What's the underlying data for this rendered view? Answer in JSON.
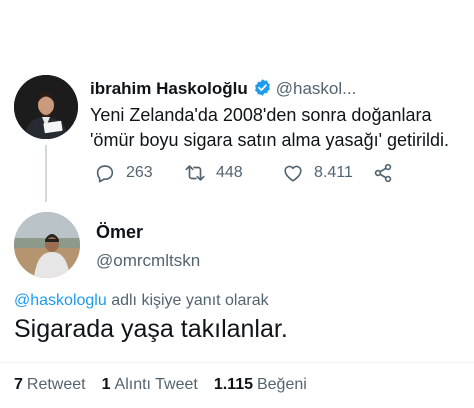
{
  "parent_tweet": {
    "author_name": "ibrahim Haskoloğlu",
    "handle": "@haskol...",
    "text": "Yeni Zelanda'da 2008'den sonra doğanlara 'ömür boyu sigara satın alma yasağı' getirildi.",
    "replies": "263",
    "retweets": "448",
    "likes": "8.411",
    "verified_color": "#1d9bf0"
  },
  "reply_tweet": {
    "author_name": "Ömer",
    "handle": "@omrcmltskn",
    "reply_to_mention": "@haskologlu",
    "reply_to_suffix": " adlı kişiye yanıt olarak",
    "text": "Sigarada yaşa takılanlar."
  },
  "stats": {
    "retweet_count": "7",
    "retweet_label": "Retweet",
    "quote_count": "1",
    "quote_label": "Alıntı Tweet",
    "like_count": "1.115",
    "like_label": "Beğeni"
  }
}
